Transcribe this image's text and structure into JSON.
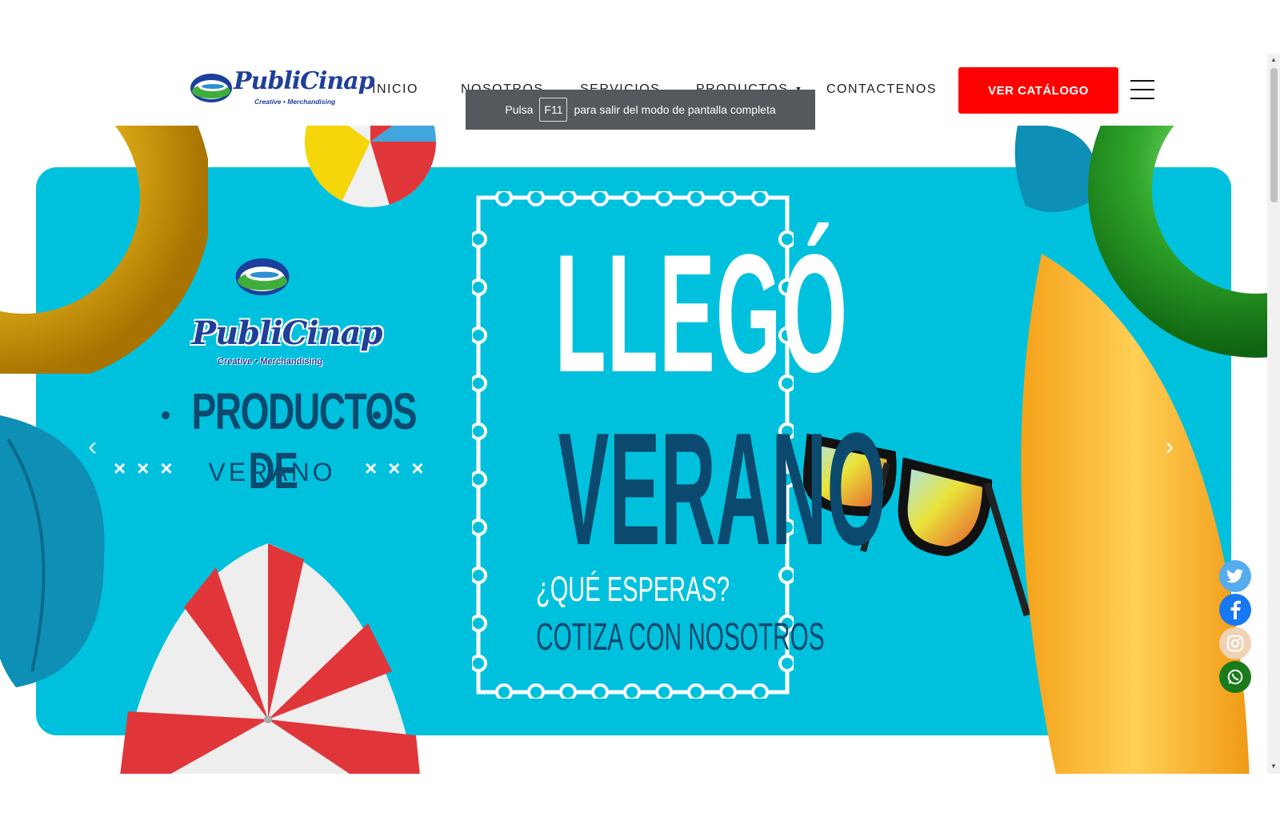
{
  "header": {
    "logo": {
      "name": "PubliCinap",
      "tagline": "Creative • Merchandising"
    },
    "nav": [
      {
        "label": "INICIO"
      },
      {
        "label": "NOSOTROS"
      },
      {
        "label": "SERVICIOS"
      },
      {
        "label": "PRODUCTOS",
        "has_dropdown": true
      },
      {
        "label": "CONTACTENOS"
      }
    ],
    "cta_label": "VER CATÁLOGO",
    "menu_icon": "hamburger-icon"
  },
  "fullscreen_toast": {
    "prefix": "Pulsa",
    "key": "F11",
    "suffix": "para salir del modo de pantalla completa"
  },
  "hero": {
    "logo": {
      "name": "PubliCinap",
      "tagline": "Creative • Merchandising"
    },
    "promo_title": "PRODUCTOS DE",
    "promo_subtitle": "VERANO",
    "headline_1": "LLEGÓ",
    "headline_2": "VERANO",
    "question": "¿QUÉ ESPERAS?",
    "call_to_action": "COTIZA CON NOSOTROS",
    "prev_icon": "chevron-left-icon",
    "next_icon": "chevron-right-icon"
  },
  "social": [
    {
      "name": "twitter-icon",
      "color": "#55acee"
    },
    {
      "name": "facebook-icon",
      "color": "#1877f2"
    },
    {
      "name": "instagram-icon",
      "color": "#f0d2b4"
    },
    {
      "name": "whatsapp-icon",
      "color": "#1b7a1b"
    }
  ],
  "colors": {
    "panel": "#00c1dd",
    "cta": "#ff0000",
    "navy": "#0b4a6e"
  }
}
